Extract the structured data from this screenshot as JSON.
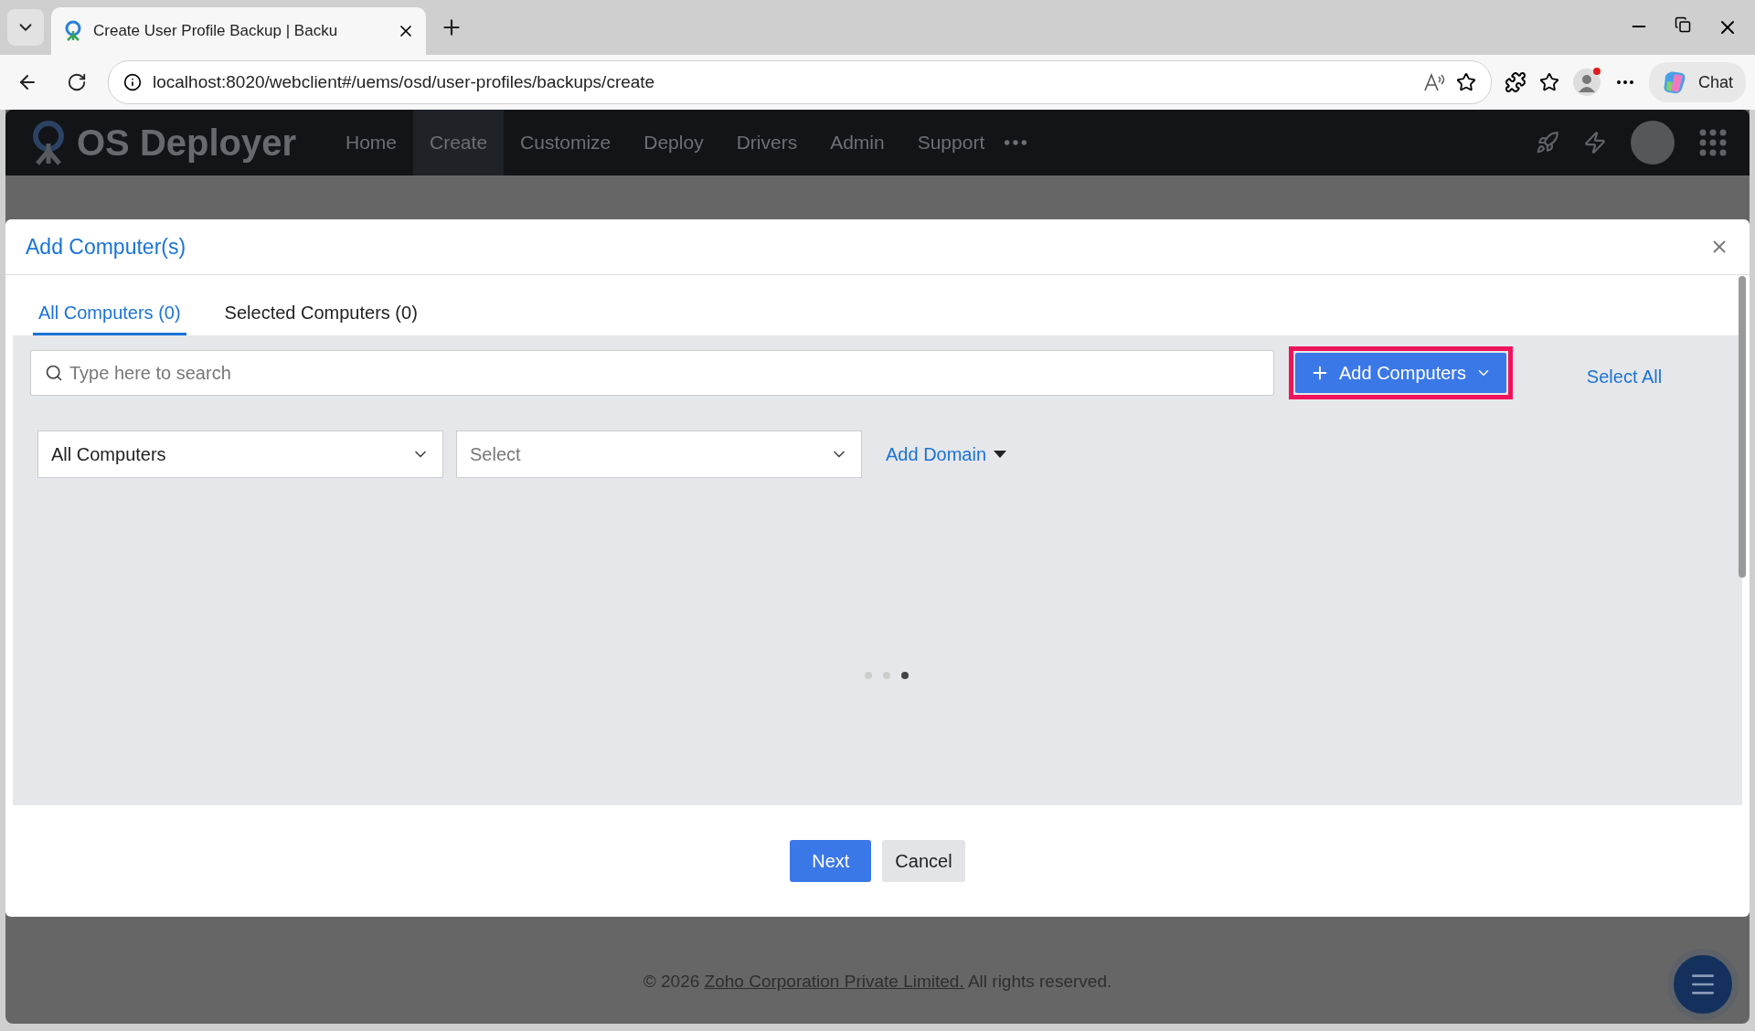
{
  "browser": {
    "tab_title": "Create User Profile Backup | Backu",
    "url": "localhost:8020/webclient#/uems/osd/user-profiles/backups/create",
    "chat_label": "Chat"
  },
  "app": {
    "logo": "OS Deployer",
    "nav": [
      {
        "label": "Home",
        "selected": false
      },
      {
        "label": "Create",
        "selected": true
      },
      {
        "label": "Customize",
        "selected": false
      },
      {
        "label": "Deploy",
        "selected": false
      },
      {
        "label": "Drivers",
        "selected": false
      },
      {
        "label": "Admin",
        "selected": false
      },
      {
        "label": "Support",
        "selected": false
      }
    ]
  },
  "modal": {
    "title": "Add Computer(s)",
    "tabs": [
      {
        "label": "All Computers (0)",
        "selected": true
      },
      {
        "label": "Selected Computers (0)",
        "selected": false
      }
    ],
    "search": {
      "placeholder": "Type here to search"
    },
    "add_button": {
      "label": "Add Computers",
      "highlighted": true
    },
    "select_all": "Select All",
    "filters": [
      {
        "value": "All Computers",
        "kind": "value"
      },
      {
        "value": "Select",
        "kind": "placeholder"
      }
    ],
    "add_domain": "Add Domain",
    "buttons": [
      {
        "label": "Next",
        "kind": "primary"
      },
      {
        "label": "Cancel",
        "kind": "secondary"
      }
    ]
  },
  "footer": {
    "prefix": "© 2026",
    "link": "Zoho Corporation Private Limited.",
    "suffix": "All rights reserved."
  }
}
